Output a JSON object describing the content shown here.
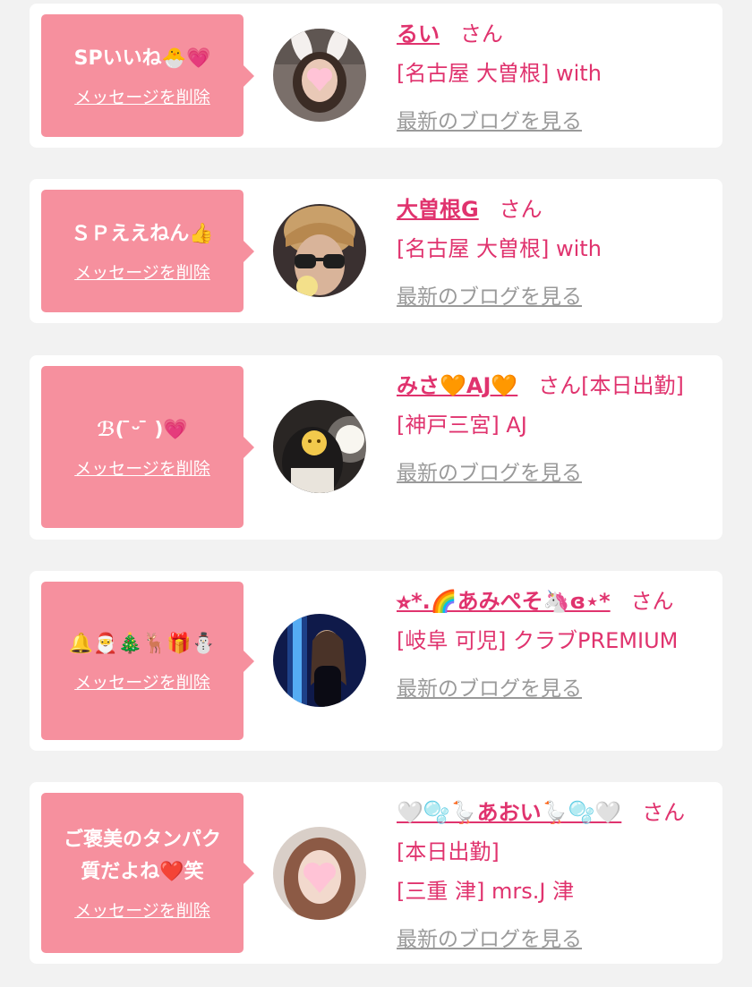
{
  "colors": {
    "page_bg": "#f2f2f2",
    "card_bg": "#ffffff",
    "bubble_bg": "#f6909e",
    "accent_pink": "#e0336e",
    "link_gray": "#9a9a9a"
  },
  "labels": {
    "delete_message": "メッセージを削除",
    "view_blog": "最新のブログを見る",
    "honorific": "さん"
  },
  "entries": [
    {
      "message": "SPいいね🐣💗",
      "name": "るい",
      "suffix": "",
      "location": "[名古屋 大曽根] with",
      "avatar_icon": "photo-bunny-ears-avatar"
    },
    {
      "message": "ＳＰええねん👍",
      "name": "大曽根G",
      "suffix": "",
      "location": "[名古屋 大曽根] with",
      "avatar_icon": "photo-sunglasses-avatar"
    },
    {
      "message": "ℬ(  ̄ᵕ ̄ )💗",
      "name": "みさ🧡AJ🧡",
      "suffix": "[本日出勤]",
      "location": "[神戸三宮] AJ",
      "avatar_icon": "photo-mirror-avatar"
    },
    {
      "message": "🔔🎅🎄🦌🎁⛄",
      "name": "⭐︎*.🌈あみぺそ🦄ɞ⋆*",
      "suffix": "",
      "location": "[岐阜 可児] クラブPREMIUM",
      "avatar_icon": "photo-blue-light-avatar"
    },
    {
      "message": "ご褒美のタンパク\n質だよね❤️笑",
      "name": "🤍🫧🪿あおい🪿🫧🤍",
      "suffix": "[本日出勤]",
      "location": "[三重 津] mrs.J 津",
      "avatar_icon": "photo-heart-face-avatar"
    }
  ]
}
